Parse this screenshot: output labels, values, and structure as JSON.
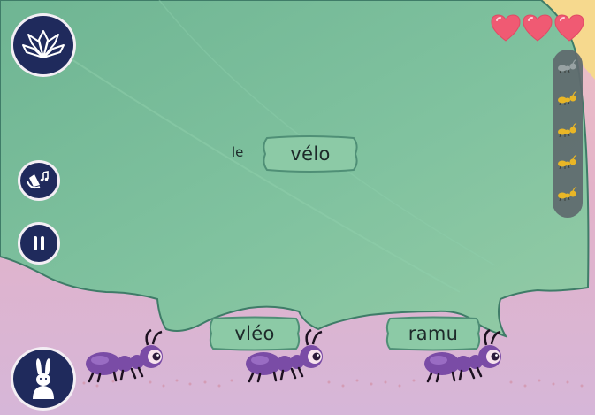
{
  "top_word": {
    "article": "le",
    "word": "vélo"
  },
  "answer_choices": [
    {
      "word": "vléo"
    },
    {
      "word": "ramu"
    }
  ],
  "lives": {
    "remaining": 3
  },
  "progress": {
    "total": 5,
    "completed": 4
  },
  "icons": {
    "menu": "lotus-icon",
    "sound": "sound-toggle-icon",
    "pause": "pause-icon",
    "character": "rabbit-icon",
    "life": "heart-icon",
    "progress_marker": "ant-icon"
  },
  "colors": {
    "leaf": "#7cbf9c",
    "leaf_dark": "#3f7c68",
    "ground_pink": "#e8b7c3",
    "ground_lilac": "#d5b5d6",
    "heart": "#f05a73",
    "button_navy": "#1f2a5c",
    "ant_purple": "#7a4ca6"
  }
}
